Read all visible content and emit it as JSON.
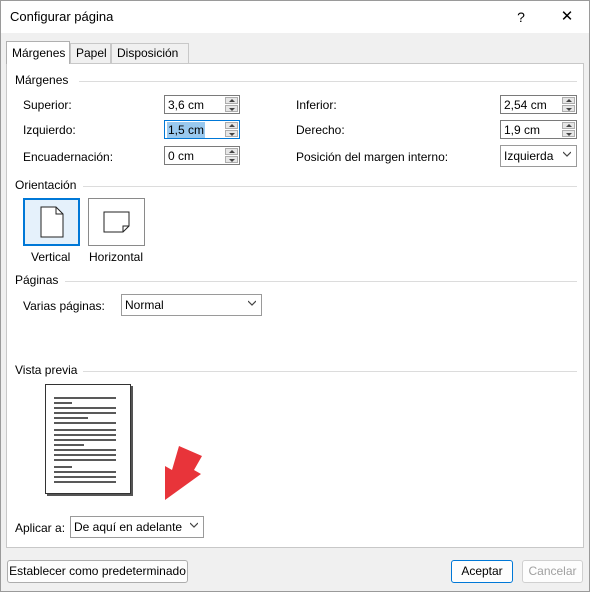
{
  "window": {
    "title": "Configurar página",
    "help_glyph": "?",
    "close_glyph": "✕"
  },
  "tabs": [
    {
      "label": "Márgenes"
    },
    {
      "label": "Papel"
    },
    {
      "label": "Disposición"
    }
  ],
  "margins": {
    "section_title": "Márgenes",
    "top_label": "Superior:",
    "top_value": "3,6 cm",
    "bottom_label": "Inferior:",
    "bottom_value": "2,54 cm",
    "left_label": "Izquierdo:",
    "left_value": "1,5 cm",
    "right_label": "Derecho:",
    "right_value": "1,9 cm",
    "gutter_label": "Encuadernación:",
    "gutter_value": "0 cm",
    "gutter_pos_label": "Posición del margen interno:",
    "gutter_pos_value": "Izquierda"
  },
  "orientation": {
    "section_title": "Orientación",
    "vertical_label": "Vertical",
    "horizontal_label": "Horizontal",
    "selected": "Vertical"
  },
  "pages": {
    "section_title": "Páginas",
    "multiple_label": "Varias páginas:",
    "multiple_value": "Normal"
  },
  "preview": {
    "section_title": "Vista previa",
    "apply_label": "Aplicar a:",
    "apply_value": "De aquí en adelante"
  },
  "footer": {
    "set_default_label": "Establecer como predeterminado",
    "accept_label": "Aceptar",
    "cancel_label": "Cancelar"
  },
  "colors": {
    "accent": "#0078d7",
    "annotation_arrow": "#e8343a"
  }
}
